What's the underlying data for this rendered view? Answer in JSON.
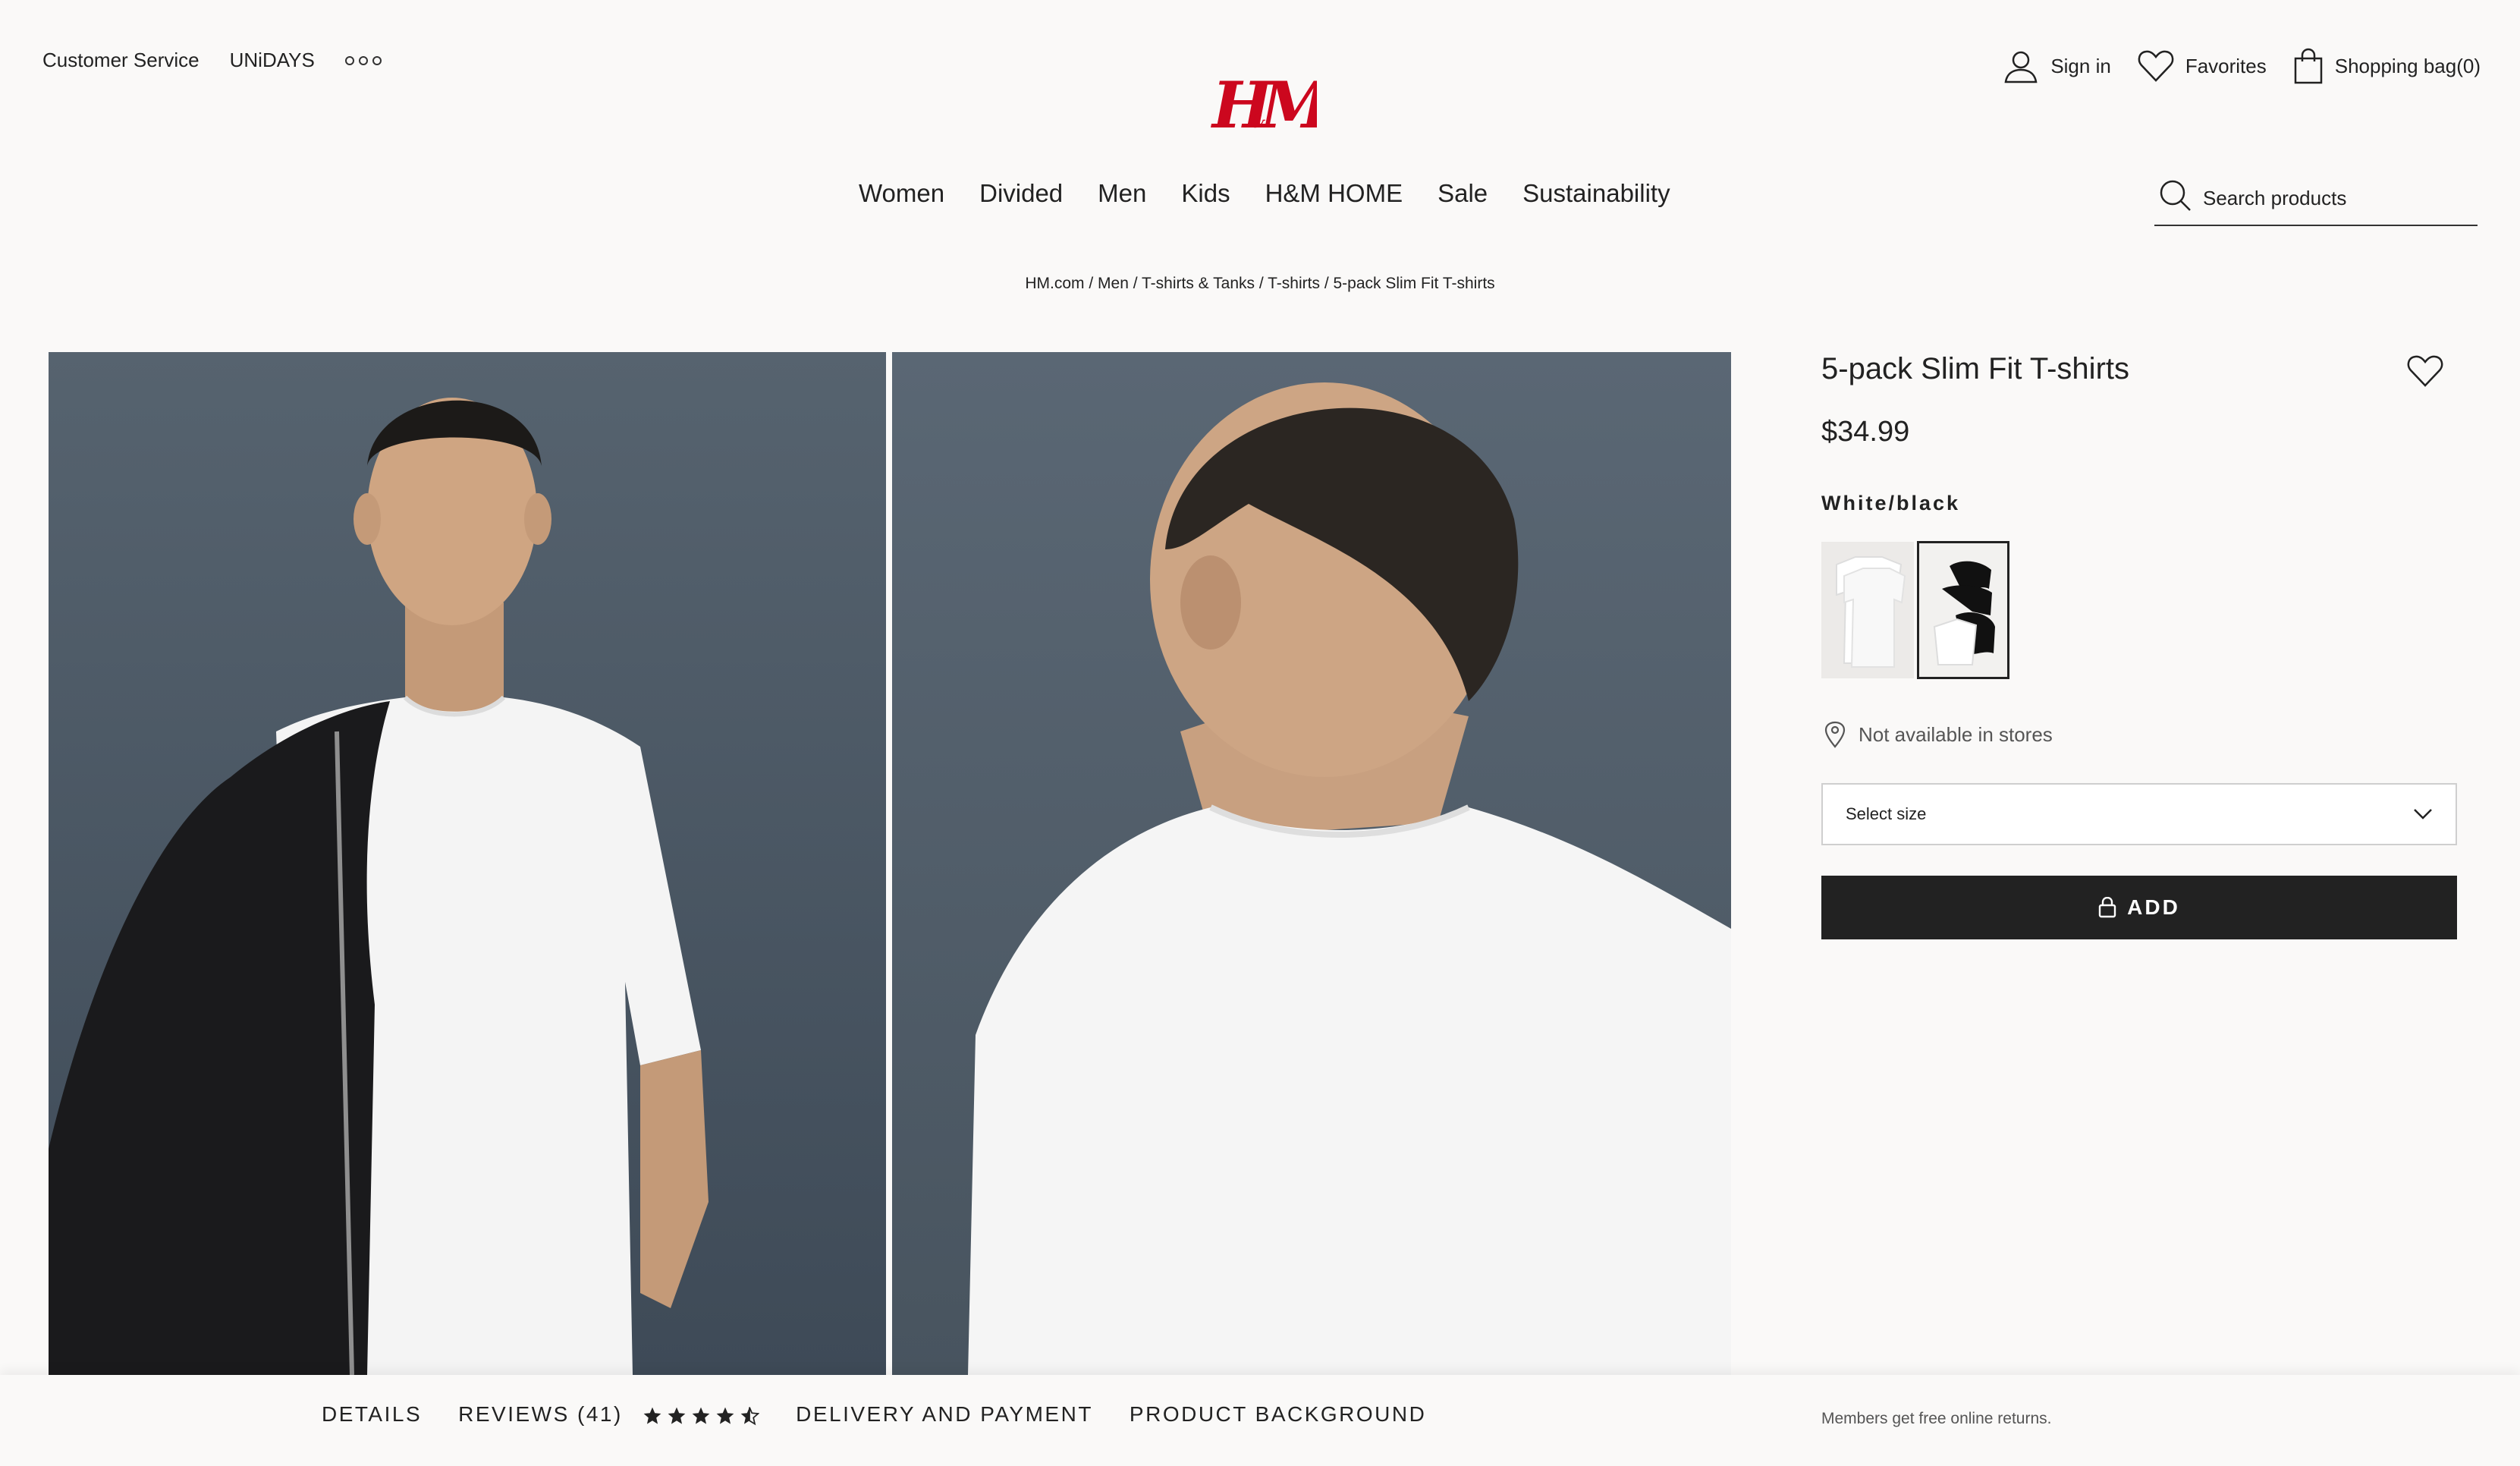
{
  "top_links": {
    "customer_service": "Customer Service",
    "unidays": "UNiDAYS"
  },
  "brand": {
    "logo_text": "H&M",
    "accent": "#cc071e"
  },
  "account": {
    "sign_in": "Sign in",
    "favorites": "Favorites",
    "bag": "Shopping bag(0)"
  },
  "nav": [
    "Women",
    "Divided",
    "Men",
    "Kids",
    "H&M HOME",
    "Sale",
    "Sustainability"
  ],
  "search": {
    "placeholder": "Search products"
  },
  "breadcrumb": [
    "HM.com",
    "Men",
    "T-shirts & Tanks",
    "T-shirts",
    "5-pack Slim Fit T-shirts"
  ],
  "product": {
    "title": "5-pack Slim Fit T-shirts",
    "price": "$34.99",
    "color_name": "White/black",
    "availability": "Not available in stores",
    "size_select": "Select size",
    "add_label": "ADD"
  },
  "bottom_tabs": {
    "details": "DETAILS",
    "reviews": "REVIEWS (41)",
    "rating": 4.5,
    "delivery": "DELIVERY AND PAYMENT",
    "background": "PRODUCT BACKGROUND"
  },
  "members_note": "Members get free online returns.",
  "icons": [
    "user-icon",
    "heart-icon",
    "bag-icon",
    "search-icon",
    "location-pin-icon",
    "chevron-down-icon",
    "lock-bag-icon",
    "star-icon"
  ]
}
